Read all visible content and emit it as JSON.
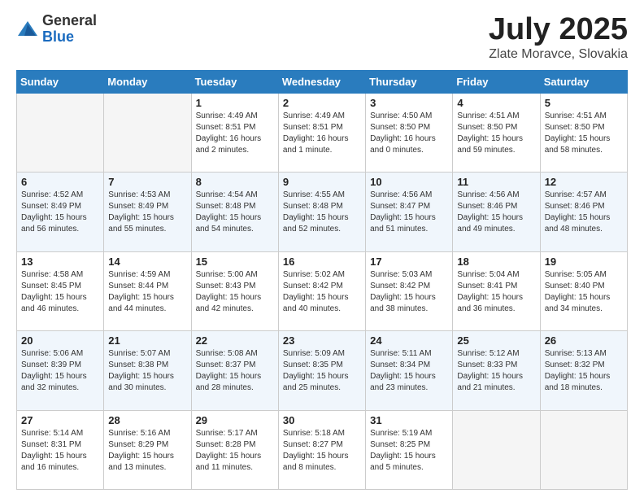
{
  "header": {
    "logo_general": "General",
    "logo_blue": "Blue",
    "month_title": "July 2025",
    "location": "Zlate Moravce, Slovakia"
  },
  "weekdays": [
    "Sunday",
    "Monday",
    "Tuesday",
    "Wednesday",
    "Thursday",
    "Friday",
    "Saturday"
  ],
  "weeks": [
    [
      {
        "day": "",
        "info": ""
      },
      {
        "day": "",
        "info": ""
      },
      {
        "day": "1",
        "info": "Sunrise: 4:49 AM\nSunset: 8:51 PM\nDaylight: 16 hours\nand 2 minutes."
      },
      {
        "day": "2",
        "info": "Sunrise: 4:49 AM\nSunset: 8:51 PM\nDaylight: 16 hours\nand 1 minute."
      },
      {
        "day": "3",
        "info": "Sunrise: 4:50 AM\nSunset: 8:50 PM\nDaylight: 16 hours\nand 0 minutes."
      },
      {
        "day": "4",
        "info": "Sunrise: 4:51 AM\nSunset: 8:50 PM\nDaylight: 15 hours\nand 59 minutes."
      },
      {
        "day": "5",
        "info": "Sunrise: 4:51 AM\nSunset: 8:50 PM\nDaylight: 15 hours\nand 58 minutes."
      }
    ],
    [
      {
        "day": "6",
        "info": "Sunrise: 4:52 AM\nSunset: 8:49 PM\nDaylight: 15 hours\nand 56 minutes."
      },
      {
        "day": "7",
        "info": "Sunrise: 4:53 AM\nSunset: 8:49 PM\nDaylight: 15 hours\nand 55 minutes."
      },
      {
        "day": "8",
        "info": "Sunrise: 4:54 AM\nSunset: 8:48 PM\nDaylight: 15 hours\nand 54 minutes."
      },
      {
        "day": "9",
        "info": "Sunrise: 4:55 AM\nSunset: 8:48 PM\nDaylight: 15 hours\nand 52 minutes."
      },
      {
        "day": "10",
        "info": "Sunrise: 4:56 AM\nSunset: 8:47 PM\nDaylight: 15 hours\nand 51 minutes."
      },
      {
        "day": "11",
        "info": "Sunrise: 4:56 AM\nSunset: 8:46 PM\nDaylight: 15 hours\nand 49 minutes."
      },
      {
        "day": "12",
        "info": "Sunrise: 4:57 AM\nSunset: 8:46 PM\nDaylight: 15 hours\nand 48 minutes."
      }
    ],
    [
      {
        "day": "13",
        "info": "Sunrise: 4:58 AM\nSunset: 8:45 PM\nDaylight: 15 hours\nand 46 minutes."
      },
      {
        "day": "14",
        "info": "Sunrise: 4:59 AM\nSunset: 8:44 PM\nDaylight: 15 hours\nand 44 minutes."
      },
      {
        "day": "15",
        "info": "Sunrise: 5:00 AM\nSunset: 8:43 PM\nDaylight: 15 hours\nand 42 minutes."
      },
      {
        "day": "16",
        "info": "Sunrise: 5:02 AM\nSunset: 8:42 PM\nDaylight: 15 hours\nand 40 minutes."
      },
      {
        "day": "17",
        "info": "Sunrise: 5:03 AM\nSunset: 8:42 PM\nDaylight: 15 hours\nand 38 minutes."
      },
      {
        "day": "18",
        "info": "Sunrise: 5:04 AM\nSunset: 8:41 PM\nDaylight: 15 hours\nand 36 minutes."
      },
      {
        "day": "19",
        "info": "Sunrise: 5:05 AM\nSunset: 8:40 PM\nDaylight: 15 hours\nand 34 minutes."
      }
    ],
    [
      {
        "day": "20",
        "info": "Sunrise: 5:06 AM\nSunset: 8:39 PM\nDaylight: 15 hours\nand 32 minutes."
      },
      {
        "day": "21",
        "info": "Sunrise: 5:07 AM\nSunset: 8:38 PM\nDaylight: 15 hours\nand 30 minutes."
      },
      {
        "day": "22",
        "info": "Sunrise: 5:08 AM\nSunset: 8:37 PM\nDaylight: 15 hours\nand 28 minutes."
      },
      {
        "day": "23",
        "info": "Sunrise: 5:09 AM\nSunset: 8:35 PM\nDaylight: 15 hours\nand 25 minutes."
      },
      {
        "day": "24",
        "info": "Sunrise: 5:11 AM\nSunset: 8:34 PM\nDaylight: 15 hours\nand 23 minutes."
      },
      {
        "day": "25",
        "info": "Sunrise: 5:12 AM\nSunset: 8:33 PM\nDaylight: 15 hours\nand 21 minutes."
      },
      {
        "day": "26",
        "info": "Sunrise: 5:13 AM\nSunset: 8:32 PM\nDaylight: 15 hours\nand 18 minutes."
      }
    ],
    [
      {
        "day": "27",
        "info": "Sunrise: 5:14 AM\nSunset: 8:31 PM\nDaylight: 15 hours\nand 16 minutes."
      },
      {
        "day": "28",
        "info": "Sunrise: 5:16 AM\nSunset: 8:29 PM\nDaylight: 15 hours\nand 13 minutes."
      },
      {
        "day": "29",
        "info": "Sunrise: 5:17 AM\nSunset: 8:28 PM\nDaylight: 15 hours\nand 11 minutes."
      },
      {
        "day": "30",
        "info": "Sunrise: 5:18 AM\nSunset: 8:27 PM\nDaylight: 15 hours\nand 8 minutes."
      },
      {
        "day": "31",
        "info": "Sunrise: 5:19 AM\nSunset: 8:25 PM\nDaylight: 15 hours\nand 5 minutes."
      },
      {
        "day": "",
        "info": ""
      },
      {
        "day": "",
        "info": ""
      }
    ]
  ]
}
